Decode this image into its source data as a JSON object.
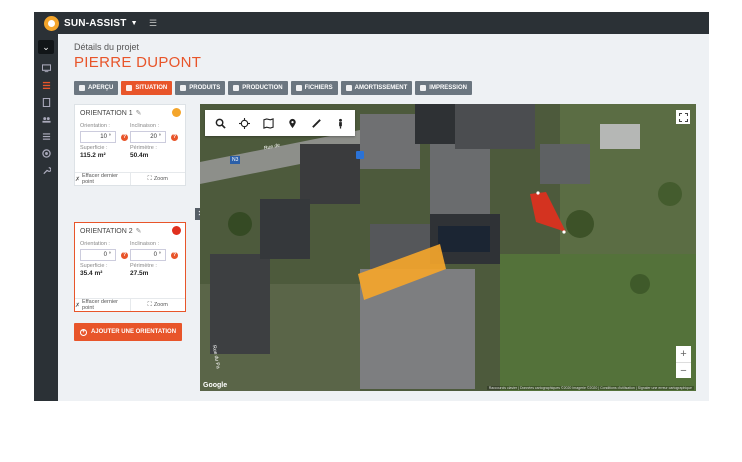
{
  "brand": {
    "name": "SUN-ASSIST"
  },
  "header": {
    "breadcrumb": "Détails du projet",
    "title": "PIERRE DUPONT"
  },
  "tabs": [
    {
      "label": "APERÇU",
      "icon": "users-icon"
    },
    {
      "label": "SITUATION",
      "icon": "map-icon",
      "active": true
    },
    {
      "label": "PRODUITS",
      "icon": "user-icon"
    },
    {
      "label": "PRODUCTION",
      "icon": "monitor-icon"
    },
    {
      "label": "FICHIERS",
      "icon": "file-icon"
    },
    {
      "label": "AMORTISSEMENT",
      "icon": "user-icon"
    },
    {
      "label": "IMPRESSION",
      "icon": "print-icon"
    }
  ],
  "orientations": [
    {
      "title": "ORIENTATION 1",
      "color": "#f4a52b",
      "orientation_label": "Orientation :",
      "orientation_value": "10 °",
      "inclinaison_label": "Inclinaison :",
      "inclinaison_value": "20 °",
      "superficie_label": "Superficie :",
      "superficie_value": "115.2 m²",
      "perimetre_label": "Périmètre :",
      "perimetre_value": "50.4m",
      "clear_label": "Effacer dernier point",
      "zoom_label": "Zoom"
    },
    {
      "title": "ORIENTATION 2",
      "color": "#e0301e",
      "orientation_label": "Orientation :",
      "orientation_value": "0 °",
      "inclinaison_label": "Inclinaison :",
      "inclinaison_value": "0 °",
      "superficie_label": "Superficie :",
      "superficie_value": "35.4 m²",
      "perimetre_label": "Périmètre :",
      "perimetre_value": "27.5m",
      "clear_label": "Effacer dernier point",
      "zoom_label": "Zoom"
    }
  ],
  "add_button": {
    "label": "AJOUTER UNE ORIENTATION"
  },
  "map": {
    "road_badge": "N3",
    "road_label_1": "Rue de",
    "road_label_2": "Rue du Pa",
    "google": "Google",
    "attribution": "Raccourcis clavier | Données cartographiques ©2020 Imagerie ©2020 | Conditions d'utilisation | Signaler une erreur cartographique",
    "zoom_in": "+",
    "zoom_out": "−"
  }
}
